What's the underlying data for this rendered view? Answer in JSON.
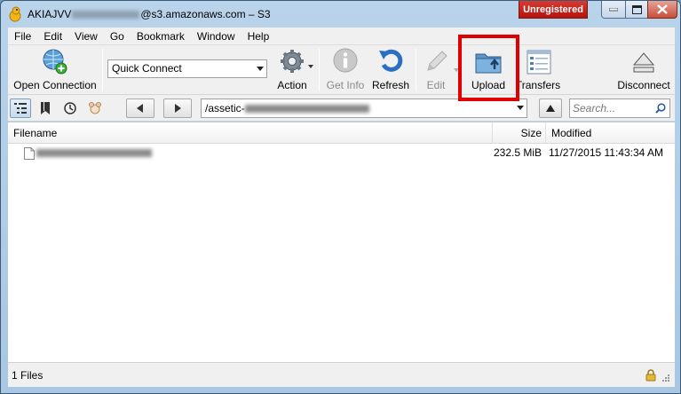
{
  "window": {
    "title_prefix": "AKIAJVV",
    "title_suffix": "@s3.amazonaws.com – S3",
    "unregistered": "Unregistered"
  },
  "menu": [
    "File",
    "Edit",
    "View",
    "Go",
    "Bookmark",
    "Window",
    "Help"
  ],
  "toolbar": {
    "open_connection": "Open Connection",
    "quick_connect": "Quick Connect",
    "action": "Action",
    "get_info": "Get Info",
    "refresh": "Refresh",
    "edit": "Edit",
    "upload": "Upload",
    "transfers": "Transfers",
    "disconnect": "Disconnect"
  },
  "pathbar": {
    "path_prefix": "/assetic-",
    "search_placeholder": "Search..."
  },
  "filelist": {
    "columns": {
      "filename": "Filename",
      "size": "Size",
      "modified": "Modified"
    },
    "rows": [
      {
        "size": "232.5 MiB",
        "modified": "11/27/2015 11:43:34 AM"
      }
    ]
  },
  "status": {
    "text": "1 Files"
  },
  "colors": {
    "highlight": "#e00000",
    "unregistered_bg": "#c4221a",
    "titlebar": "#b9d3ea"
  }
}
